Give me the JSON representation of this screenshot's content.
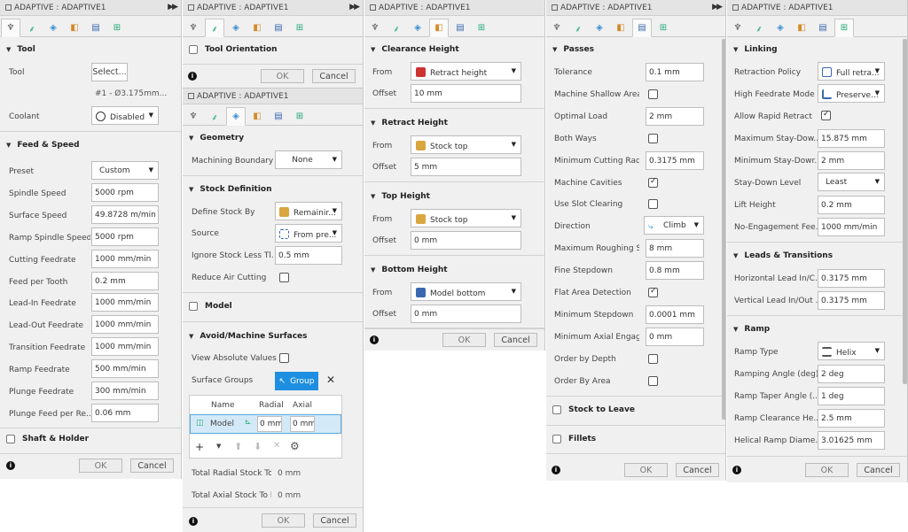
{
  "panel1": {
    "title": "ADAPTIVE : ADAPTIVE1",
    "tool_section": "Tool",
    "tool_label": "Tool",
    "tool_button": "Select...",
    "tool_desc": "#1 - Ø3.175mm...",
    "coolant_label": "Coolant",
    "coolant_value": "Disabled",
    "feed_section": "Feed & Speed",
    "rows": [
      {
        "label": "Preset",
        "value": "Custom"
      },
      {
        "label": "Spindle Speed",
        "value": "5000 rpm"
      },
      {
        "label": "Surface Speed",
        "value": "49.8728 m/min"
      },
      {
        "label": "Ramp Spindle Speed",
        "value": "5000 rpm"
      },
      {
        "label": "Cutting Feedrate",
        "value": "1000 mm/min"
      },
      {
        "label": "Feed per Tooth",
        "value": "0.2 mm"
      },
      {
        "label": "Lead-In Feedrate",
        "value": "1000 mm/min"
      },
      {
        "label": "Lead-Out Feedrate",
        "value": "1000 mm/min"
      },
      {
        "label": "Transition Feedrate",
        "value": "1000 mm/min"
      },
      {
        "label": "Ramp Feedrate",
        "value": "500 mm/min"
      },
      {
        "label": "Plunge Feedrate",
        "value": "300 mm/min"
      },
      {
        "label": "Plunge Feed per Re...",
        "value": "0.06 mm"
      }
    ],
    "shaft_section": "Shaft & Holder",
    "ok": "OK",
    "cancel": "Cancel"
  },
  "panel2": {
    "orientation_section": "Tool Orientation",
    "ok": "OK",
    "cancel": "Cancel",
    "title": "ADAPTIVE : ADAPTIVE1",
    "geometry_section": "Geometry",
    "machining_boundary_label": "Machining Boundary",
    "machining_boundary_value": "None",
    "stock_section": "Stock Definition",
    "define_stock_label": "Define Stock By",
    "define_stock_value": "Remainir...",
    "source_label": "Source",
    "source_value": "From pre...",
    "ignore_label": "Ignore Stock Less Tl...",
    "ignore_value": "0.5 mm",
    "reduce_label": "Reduce Air Cutting",
    "model_section": "Model",
    "avoid_section": "Avoid/Machine Surfaces",
    "view_abs_label": "View Absolute Values",
    "surface_groups_label": "Surface Groups",
    "group_button": "Group",
    "col_name": "Name",
    "col_radial": "Radial",
    "col_axial": "Axial",
    "row_name": "Model",
    "row_radial": "0 mm",
    "row_axial": "0 mm",
    "total_radial_label": "Total Radial Stock To...",
    "total_radial_value": "0 mm",
    "total_axial_label": "Total Axial Stock To l...",
    "total_axial_value": "0 mm",
    "ok2": "OK",
    "cancel2": "Cancel"
  },
  "panel3": {
    "title": "ADAPTIVE : ADAPTIVE1",
    "clearance_section": "Clearance Height",
    "clearance_from": "Retract height",
    "clearance_offset": "10 mm",
    "retract_section": "Retract Height",
    "retract_from": "Stock top",
    "retract_offset": "5 mm",
    "top_section": "Top Height",
    "top_from": "Stock top",
    "top_offset": "0 mm",
    "bottom_section": "Bottom Height",
    "bottom_from": "Model bottom",
    "bottom_offset": "0 mm",
    "from_label": "From",
    "offset_label": "Offset",
    "ok": "OK",
    "cancel": "Cancel"
  },
  "panel4": {
    "title": "ADAPTIVE : ADAPTIVE1",
    "passes_section": "Passes",
    "tolerance_label": "Tolerance",
    "tolerance_value": "0.1 mm",
    "shallow_label": "Machine Shallow Areas",
    "optimal_label": "Optimal Load",
    "optimal_value": "2 mm",
    "both_label": "Both Ways",
    "min_cut_label": "Minimum Cutting Radi...",
    "min_cut_value": "0.3175 mm",
    "cavities_label": "Machine Cavities",
    "slot_label": "Use Slot Clearing",
    "direction_label": "Direction",
    "direction_value": "Climb",
    "max_rough_label": "Maximum Roughing S...",
    "max_rough_value": "8 mm",
    "fine_label": "Fine Stepdown",
    "fine_value": "0.8 mm",
    "flat_label": "Flat Area Detection",
    "min_step_label": "Minimum Stepdown",
    "min_step_value": "0.0001 mm",
    "min_axial_label": "Minimum Axial Engage...",
    "min_axial_value": "0 mm",
    "order_depth_label": "Order by Depth",
    "order_area_label": "Order By Area",
    "stock_leave_section": "Stock to Leave",
    "fillets_section": "Fillets",
    "ok": "OK",
    "cancel": "Cancel"
  },
  "panel5": {
    "title": "ADAPTIVE : ADAPTIVE1",
    "linking_section": "Linking",
    "retraction_label": "Retraction Policy",
    "retraction_value": "Full retra...",
    "high_feed_label": "High Feedrate Mode",
    "high_feed_value": "Preserve...",
    "rapid_label": "Allow Rapid Retract",
    "max_stay_label": "Maximum Stay-Dow...",
    "max_stay_value": "15.875 mm",
    "min_stay_label": "Minimum Stay-Dowr...",
    "min_stay_value": "2 mm",
    "stay_level_label": "Stay-Down Level",
    "stay_level_value": "Least",
    "lift_label": "Lift Height",
    "lift_value": "0.2 mm",
    "noeng_label": "No-Engagement Fee...",
    "noeng_value": "1000 mm/min",
    "leads_section": "Leads & Transitions",
    "horiz_label": "Horizontal Lead In/C...",
    "horiz_value": "0.3175 mm",
    "vert_label": "Vertical Lead In/Out ...",
    "vert_value": "0.3175 mm",
    "ramp_section": "Ramp",
    "ramp_type_label": "Ramp Type",
    "ramp_type_value": "Helix",
    "ramp_angle_label": "Ramping Angle (deg)",
    "ramp_angle_value": "2 deg",
    "taper_label": "Ramp Taper Angle (...",
    "taper_value": "1 deg",
    "clearance_label": "Ramp Clearance He...",
    "clearance_value": "2.5 mm",
    "helical_label": "Helical Ramp Diame...",
    "helical_value": "3.01625 mm",
    "ok": "OK",
    "cancel": "Cancel"
  },
  "icons": [
    "tool-icon",
    "toolpath-icon",
    "geometry-icon",
    "heights-icon",
    "passes-icon",
    "linking-icon"
  ],
  "colors": {
    "accent": "#1e8fe0",
    "panel_bg": "#f0f0f0"
  }
}
